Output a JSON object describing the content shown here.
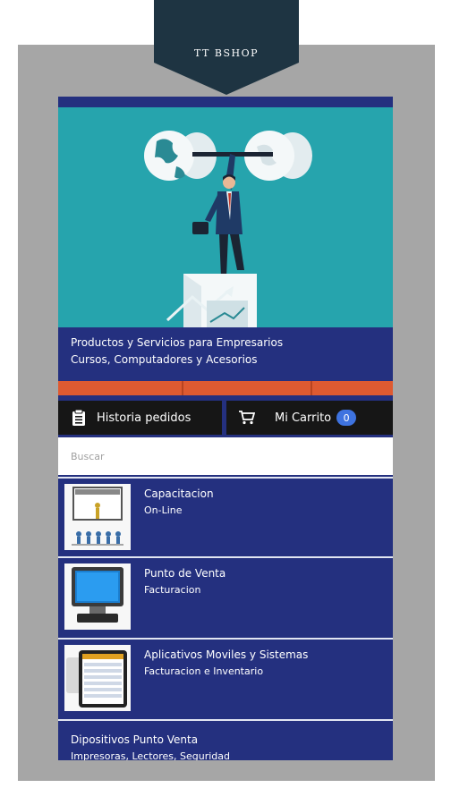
{
  "banner": {
    "title": "TT BSHOP"
  },
  "tagline": {
    "line1": "Productos y Servicios para Empresarios",
    "line2": "Cursos, Computadores y Acesorios"
  },
  "actions": {
    "history_label": "Historia pedidos",
    "cart_label": "Mi Carrito",
    "cart_count": "0"
  },
  "search": {
    "placeholder": "Buscar"
  },
  "items": [
    {
      "title": "Capacitacion",
      "subtitle": "On-Line",
      "icon": "presentation-icon"
    },
    {
      "title": "Punto de Venta",
      "subtitle": "Facturacion",
      "icon": "monitor-icon"
    },
    {
      "title": "Aplicativos Moviles y Sistemas",
      "subtitle": "Facturacion e Inventario",
      "icon": "tablet-icon"
    },
    {
      "title": "Dipositivos Punto Venta",
      "subtitle": "Impresoras, Lectores, Seguridad",
      "icon": ""
    }
  ],
  "colors": {
    "screen_bg": "#24307f",
    "hero_bg": "#26a4ad",
    "accent_bar": "#de5a31",
    "banner_bg": "#1e3442",
    "badge": "#3e73e0",
    "button_bg": "#161616"
  }
}
